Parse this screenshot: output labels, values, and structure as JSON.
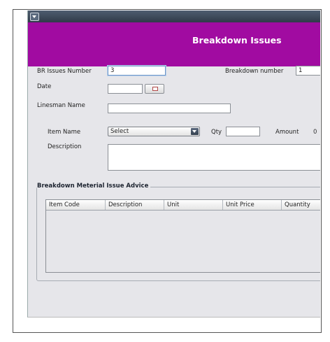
{
  "window": {
    "banner_title": "Breakdown Issues"
  },
  "form": {
    "br_issues_number": {
      "label": "BR Issues Number",
      "value": "3"
    },
    "breakdown_number": {
      "label": "Breakdown number",
      "value": "1"
    },
    "date": {
      "label": "Date",
      "value": ""
    },
    "linesman_name": {
      "label": "Linesman Name",
      "value": ""
    },
    "item_name": {
      "label": "Item Name",
      "selected": "Select"
    },
    "qty": {
      "label": "Qty",
      "value": ""
    },
    "amount": {
      "label": "Amount",
      "value": "0"
    },
    "description": {
      "label": "Description",
      "value": ""
    }
  },
  "advice": {
    "title": "Breakdown Meterial Issue Advice",
    "columns": [
      "Item Code",
      "Description",
      "Unit",
      "Unit Price",
      "Quantity"
    ]
  },
  "icons": {
    "date_button": "calendar-icon",
    "system_menu": "window-menu-icon",
    "dropdown": "chevron-down-icon"
  },
  "colors": {
    "banner": "#a10ba1",
    "titlebar": "#3a4656",
    "panel": "#e6e6ea"
  }
}
